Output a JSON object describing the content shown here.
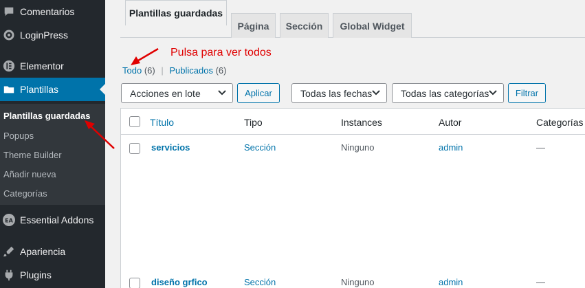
{
  "sidebar": {
    "items": [
      {
        "label": "Comentarios",
        "icon": "comment-icon"
      },
      {
        "label": "LoginPress",
        "icon": "gear-icon"
      },
      {
        "label": "Elementor",
        "icon": "elementor-icon"
      },
      {
        "label": "Plantillas",
        "icon": "folder-icon"
      },
      {
        "label": "Essential Addons",
        "icon": "ea-icon"
      },
      {
        "label": "Apariencia",
        "icon": "brush-icon"
      },
      {
        "label": "Plugins",
        "icon": "plugin-icon"
      }
    ],
    "submenu": [
      "Plantillas guardadas",
      "Popups",
      "Theme Builder",
      "Añadir nueva",
      "Categorías"
    ]
  },
  "tabs": [
    "Plantillas guardadas",
    "Página",
    "Sección",
    "Global Widget"
  ],
  "annotation": "Pulsa para ver todos",
  "views": {
    "all_label": "Todo",
    "all_count": "(6)",
    "sep": "|",
    "published_label": "Publicados",
    "published_count": "(6)"
  },
  "filters": {
    "bulk": "Acciones en lote",
    "apply": "Aplicar",
    "dates": "Todas las fechas",
    "categories": "Todas las categorías",
    "filter": "Filtrar"
  },
  "table": {
    "columns": [
      "Título",
      "Tipo",
      "Instances",
      "Autor",
      "Categorías"
    ],
    "rows": [
      {
        "title": "servicios",
        "type": "Sección",
        "instances": "Ninguno",
        "author": "admin",
        "categories": "—"
      },
      {
        "title": "diseño grfico",
        "type": "Sección",
        "instances": "Ninguno",
        "author": "admin",
        "categories": "—"
      }
    ]
  },
  "colors": {
    "accent": "#0073aa",
    "sidebar": "#23282d",
    "annotation": "#e00000"
  }
}
